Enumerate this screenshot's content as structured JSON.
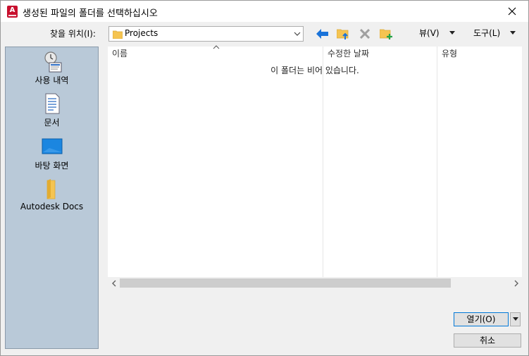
{
  "window": {
    "title": "생성된 파일의 폴더를 선택하십시오",
    "app_icon_letter": "A"
  },
  "toolbar": {
    "look_in_label": "찾을 위치(I):",
    "look_in_value": "Projects",
    "views_label": "뷰(V)",
    "tools_label": "도구(L)",
    "icons": [
      "back-arrow-icon",
      "up-folder-icon",
      "delete-icon",
      "new-folder-icon"
    ]
  },
  "places": [
    {
      "label": "사용 내역",
      "icon": "history-icon"
    },
    {
      "label": "문서",
      "icon": "documents-icon"
    },
    {
      "label": "바탕 화면",
      "icon": "desktop-icon"
    },
    {
      "label": "Autodesk Docs",
      "icon": "autodesk-docs-folder-icon"
    }
  ],
  "file_list": {
    "columns": [
      "이름",
      "수정한 날짜",
      "유형"
    ],
    "empty_message": "이 폴더는 비어 있습니다."
  },
  "buttons": {
    "open": "열기(O)",
    "cancel": "취소"
  },
  "colors": {
    "places_bg": "#b9c9d8",
    "accent_blue": "#0078d7",
    "folder_yellow": "#f5c451",
    "brand_red": "#c8102e"
  }
}
